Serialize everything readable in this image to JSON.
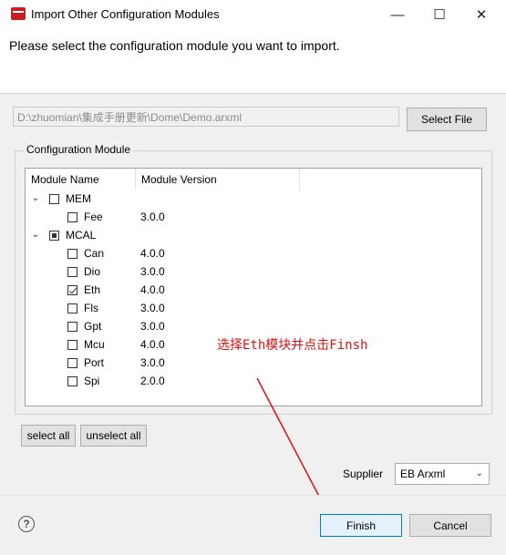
{
  "window": {
    "title": "Import Other Configuration Modules",
    "minimize_glyph": "—",
    "maximize_glyph": "☐",
    "close_glyph": "✕"
  },
  "header": {
    "instruction": "Please select the configuration module you want to import."
  },
  "file": {
    "path": "D:\\zhuomian\\集成手册更新\\Dome\\Demo.arxml",
    "select_file_label": "Select File"
  },
  "module_group": {
    "label": "Configuration Module",
    "columns": [
      "Module Name",
      "Module Version"
    ],
    "rows": [
      {
        "name": "MEM",
        "version": "",
        "level": 0,
        "expanded": true,
        "state": "unchecked"
      },
      {
        "name": "Fee",
        "version": "3.0.0",
        "level": 1,
        "state": "unchecked"
      },
      {
        "name": "MCAL",
        "version": "",
        "level": 0,
        "expanded": true,
        "state": "partial"
      },
      {
        "name": "Can",
        "version": "4.0.0",
        "level": 1,
        "state": "unchecked"
      },
      {
        "name": "Dio",
        "version": "3.0.0",
        "level": 1,
        "state": "unchecked"
      },
      {
        "name": "Eth",
        "version": "4.0.0",
        "level": 1,
        "state": "checked"
      },
      {
        "name": "Fls",
        "version": "3.0.0",
        "level": 1,
        "state": "unchecked"
      },
      {
        "name": "Gpt",
        "version": "3.0.0",
        "level": 1,
        "state": "unchecked"
      },
      {
        "name": "Mcu",
        "version": "4.0.0",
        "level": 1,
        "state": "unchecked"
      },
      {
        "name": "Port",
        "version": "3.0.0",
        "level": 1,
        "state": "unchecked"
      },
      {
        "name": "Spi",
        "version": "2.0.0",
        "level": 1,
        "state": "unchecked"
      }
    ],
    "expanded_glyph": "⌄"
  },
  "selection": {
    "select_all_label": "select all",
    "unselect_all_label": "unselect all"
  },
  "supplier": {
    "label": "Supplier",
    "value": "EB Arxml",
    "chevron_glyph": "⌄"
  },
  "annotation": {
    "text": "选择Eth模块并点击Finsh",
    "color": "#e01010"
  },
  "footer": {
    "help_glyph": "?",
    "finish_label": "Finish",
    "cancel_label": "Cancel"
  }
}
